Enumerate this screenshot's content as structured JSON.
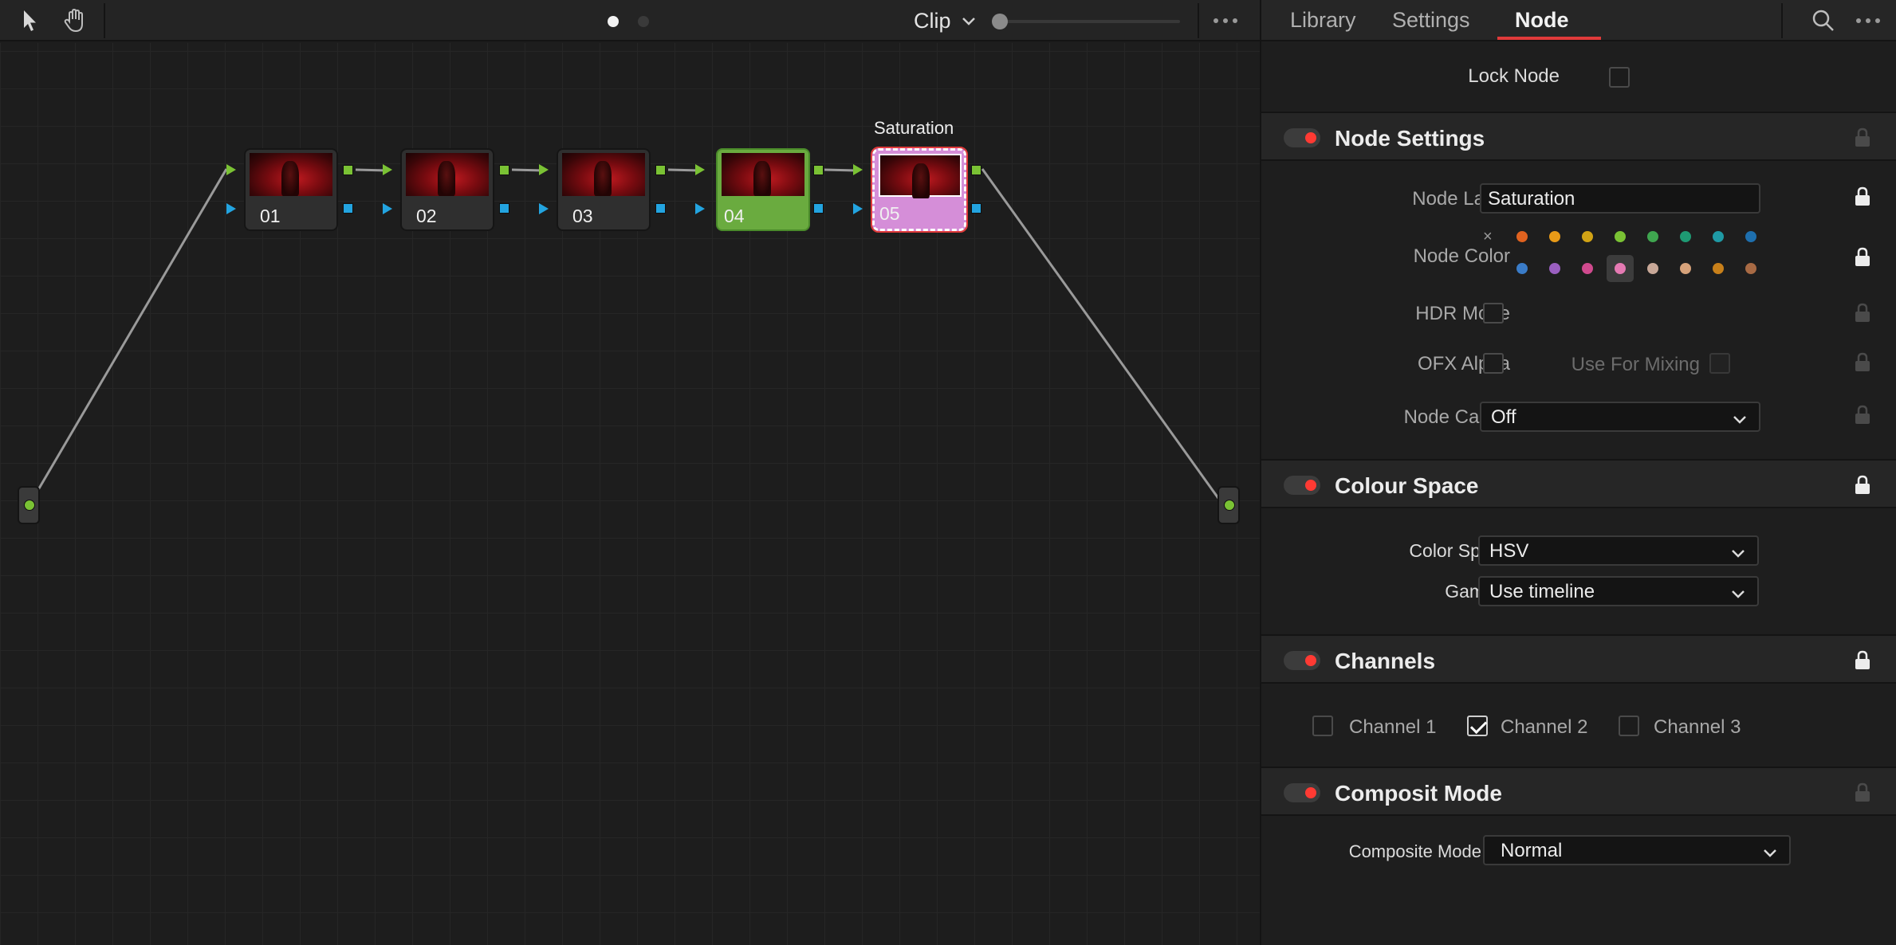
{
  "toolbar": {
    "pointer_icon": "arrow-pointer-icon",
    "hand_icon": "hand-pan-icon",
    "page_dots": 2,
    "active_page": 1,
    "view_label": "Clip",
    "zoom_fraction": 0.0
  },
  "nodes": [
    {
      "number": "01",
      "style": "default"
    },
    {
      "number": "02",
      "style": "default"
    },
    {
      "number": "03",
      "style": "default"
    },
    {
      "number": "04",
      "style": "green"
    },
    {
      "number": "05",
      "style": "pink",
      "label": "Saturation",
      "selected": true
    }
  ],
  "tabs": [
    {
      "label": "Library",
      "active": false
    },
    {
      "label": "Settings",
      "active": false
    },
    {
      "label": "Node",
      "active": true
    }
  ],
  "lock_node": {
    "label": "Lock Node",
    "checked": false
  },
  "node_settings": {
    "title": "Node Settings",
    "node_label": {
      "label": "Node Label",
      "value": "Saturation"
    },
    "node_color": {
      "label": "Node Color",
      "none_symbol": "×",
      "row1": [
        "#e0621f",
        "#e89a17",
        "#d2a315",
        "#7ac234",
        "#3fa54f",
        "#1e9a73",
        "#1f9aa5",
        "#1e6fae"
      ],
      "row2": [
        "#3a7cc8",
        "#9a5fc0",
        "#d04a8e",
        "#e57ab3",
        "#c8a898",
        "#d6a27a",
        "#c8801a",
        "#a86a44"
      ],
      "selected": "#e57ab3"
    },
    "hdr_mode": {
      "label": "HDR Mode",
      "checked": false
    },
    "ofx_alpha": {
      "label": "OFX Alpha",
      "checked": false
    },
    "use_for_mixing": {
      "label": "Use For Mixing",
      "checked": false
    },
    "node_cache": {
      "label": "Node Cache",
      "value": "Off"
    }
  },
  "colour_space": {
    "title": "Colour Space",
    "color_space": {
      "label": "Color Space",
      "value": "HSV"
    },
    "gamma": {
      "label": "Gamma",
      "value": "Use timeline"
    }
  },
  "channels": {
    "title": "Channels",
    "items": [
      {
        "label": "Channel 1",
        "checked": false
      },
      {
        "label": "Channel 2",
        "checked": true
      },
      {
        "label": "Channel 3",
        "checked": false
      }
    ]
  },
  "composite": {
    "title": "Composit Mode",
    "mode": {
      "label": "Composite Mode",
      "value": "Normal"
    }
  },
  "colors": {
    "accent_red": "#e03a3a",
    "toggle_red": "#ff3a33",
    "port_green": "#7ac234",
    "port_blue": "#23a4e0"
  }
}
